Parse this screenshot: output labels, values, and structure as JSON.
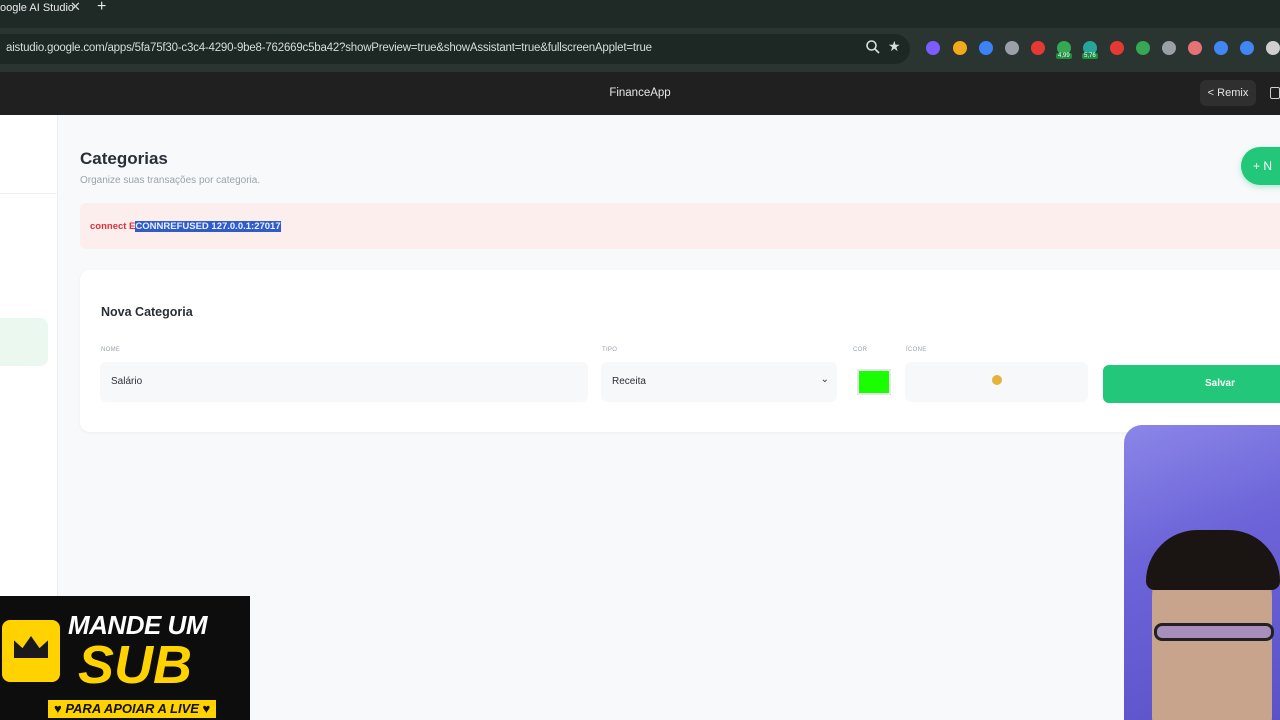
{
  "browser": {
    "tab_title": "oogle AI Studio",
    "tab_close": "✕",
    "new_tab": "+",
    "url": "aistudio.google.com/apps/5fa75f30-c3c4-4290-9be8-762669c5ba42?showPreview=true&showAssistant=true&fullscreenApplet=true",
    "zoom_icon": "zoom-icon",
    "star_icon": "★",
    "extensions": [
      {
        "name": "chrome-ext-1",
        "color": "#7b5cff"
      },
      {
        "name": "chrome-ext-2",
        "color": "#f4a81d"
      },
      {
        "name": "chrome-ext-3",
        "color": "#3b82f6"
      },
      {
        "name": "chrome-ext-4",
        "color": "#9aa0a6"
      },
      {
        "name": "chrome-ext-5",
        "color": "#e53935"
      },
      {
        "name": "chrome-ext-6",
        "color": "#34a853",
        "badge": "4,99"
      },
      {
        "name": "chrome-ext-7",
        "color": "#26a69a",
        "badge": "5,76"
      },
      {
        "name": "chrome-ext-8",
        "color": "#e53935"
      },
      {
        "name": "chrome-ext-9",
        "color": "#34a853"
      },
      {
        "name": "chrome-ext-10",
        "color": "#9aa0a6"
      },
      {
        "name": "chrome-ext-11",
        "color": "#e57373"
      },
      {
        "name": "chrome-ext-12",
        "color": "#4285f4"
      },
      {
        "name": "chrome-ext-13",
        "color": "#4285f4"
      },
      {
        "name": "chrome-ext-14",
        "color": "#cfcfcf"
      }
    ]
  },
  "appbar": {
    "title": "FinanceApp",
    "remix_label": "< Remix"
  },
  "page": {
    "title": "Categorias",
    "subtitle": "Organize suas transações por categoria.",
    "new_button_label": "+ N"
  },
  "error": {
    "prefix": "connect E",
    "selected": "CONNREFUSED 127.0.0.1:27017"
  },
  "form": {
    "title": "Nova Categoria",
    "name_label": "Nome",
    "name_value": "Salário",
    "type_label": "Tipo",
    "type_value": "Receita",
    "color_label": "Cor",
    "color_value": "#1aff00",
    "icon_label": "Ícone",
    "icon_value": "coin-emoji",
    "save_label": "Salvar"
  },
  "overlay": {
    "line1": "MANDE UM",
    "line2": "SUB",
    "line3": "♥ PARA APOIAR A LIVE ♥"
  },
  "colors": {
    "accent": "#22c77a",
    "error_bg": "#fdeeee",
    "error_text": "#e0303c"
  }
}
